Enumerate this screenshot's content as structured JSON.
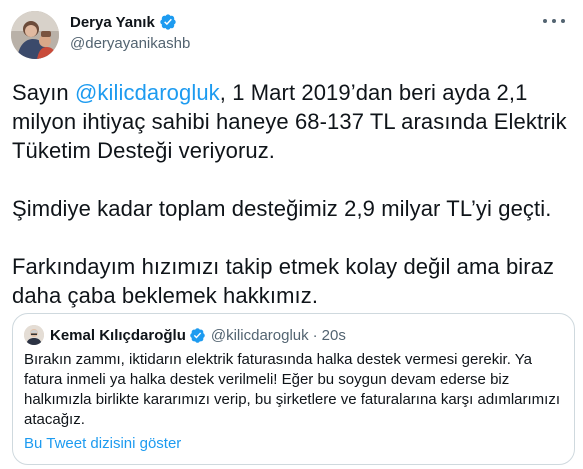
{
  "author": {
    "name": "Derya Yanık",
    "handle": "@deryayanikashb",
    "verified": true,
    "avatar_icon": "user-photo-icon"
  },
  "tweet": {
    "mention": "@kilicdarogluk",
    "para1_before": "Sayın ",
    "para1_after": ", 1 Mart 2019’dan beri ayda 2,1 milyon ihtiyaç sahibi haneye 68-137 TL arasında Elektrik Tüketim Desteği veriyoruz.",
    "para2": "Şimdiye kadar toplam desteğimiz 2,9 milyar TL’yi geçti.",
    "para3": "Farkındayım hızımızı takip etmek kolay değil ama biraz daha çaba beklemek hakkımız."
  },
  "quoted": {
    "name": "Kemal Kılıçdaroğlu",
    "handle": "@kilicdarogluk",
    "separator": "·",
    "time": "20s",
    "text": "Bırakın zammı, iktidarın elektrik faturasında halka destek vermesi gerekir. Ya fatura inmeli ya halka destek verilmeli! Eğer bu soygun devam ederse biz halkımızla birlikte kararımızı verip, bu şirketlere ve faturalarına karşı adımlarımızı atacağız.",
    "thread_link": "Bu Tweet dizisini göster"
  },
  "colors": {
    "accent": "#1d9bf0",
    "text": "#0f1419",
    "secondary": "#536471",
    "border": "#cfd9de"
  }
}
